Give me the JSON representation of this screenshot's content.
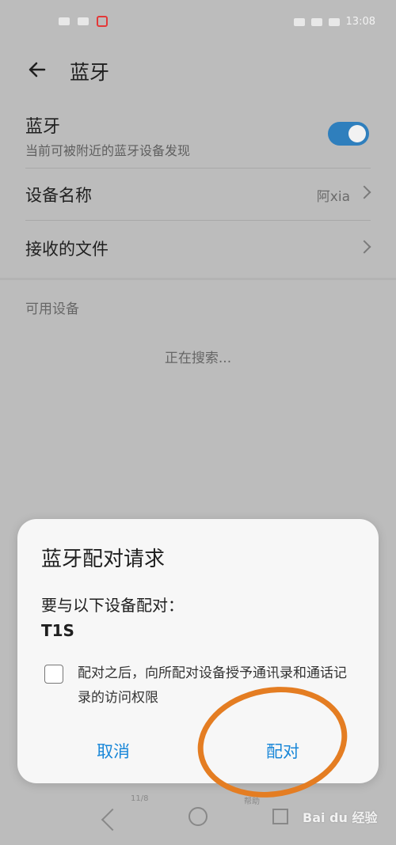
{
  "status_bar": {
    "time": "13:08"
  },
  "header": {
    "title": "蓝牙"
  },
  "bluetooth": {
    "label": "蓝牙",
    "subtitle": "当前可被附近的蓝牙设备发现",
    "enabled": true
  },
  "device_name": {
    "label": "设备名称",
    "value": "阿xia"
  },
  "received_files": {
    "label": "接收的文件"
  },
  "available_devices": {
    "label": "可用设备",
    "searching": "正在搜索..."
  },
  "dialog": {
    "title": "蓝牙配对请求",
    "message": "要与以下设备配对：",
    "device": "T1S",
    "checkbox_text": "配对之后，向所配对设备授予通讯录和通话记录的访问权限",
    "cancel_label": "取消",
    "pair_label": "配对"
  },
  "bottom_overlay": {
    "left_text": "11/8",
    "right_text": "帮助"
  },
  "watermark": "Bai du 经验",
  "colors": {
    "accent": "#1987d8",
    "toggle": "#2f7fbd",
    "annotation": "#e47d22"
  }
}
